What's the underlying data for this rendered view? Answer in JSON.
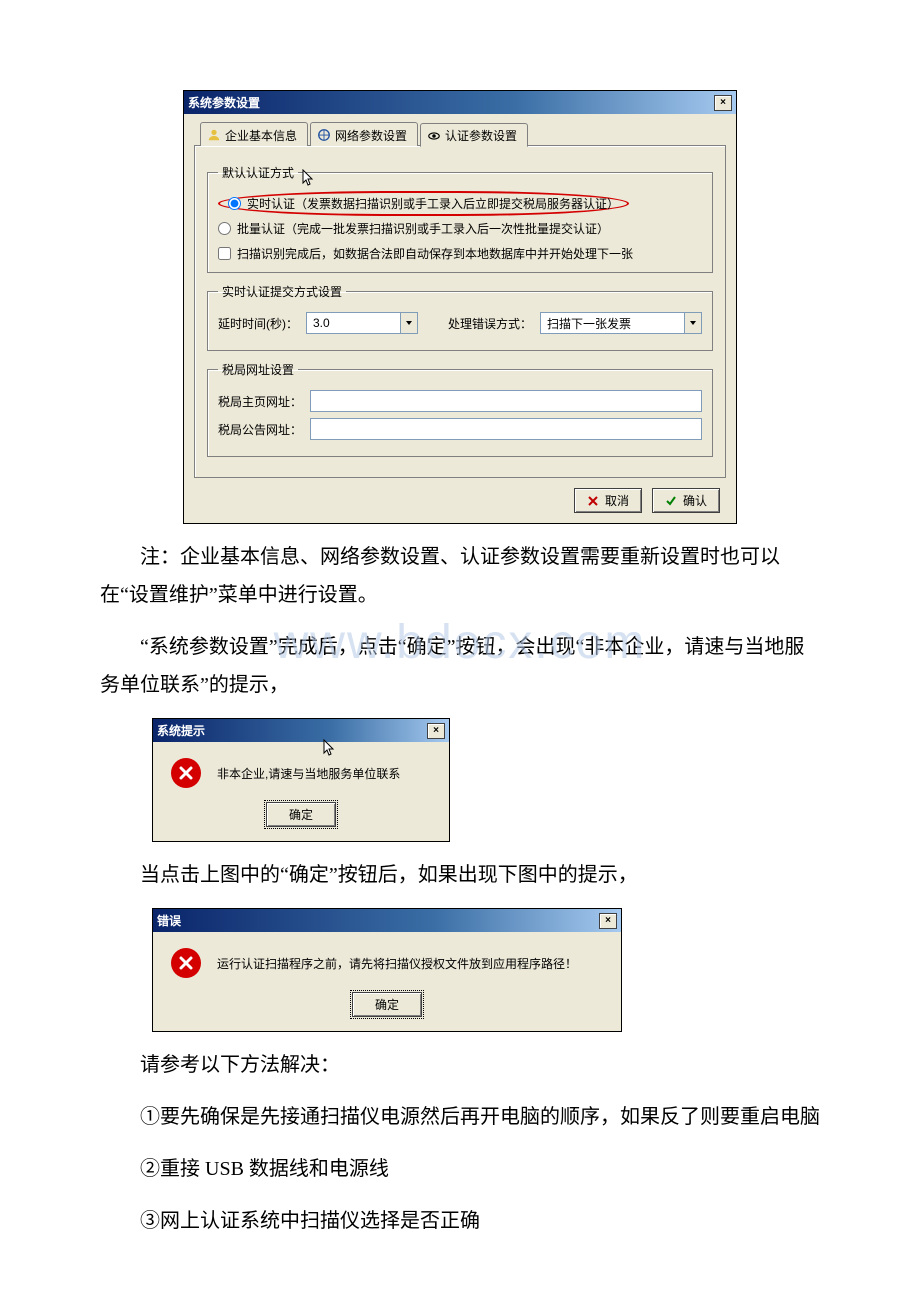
{
  "watermark": "www.bdocx.com",
  "dialog1": {
    "title": "系统参数设置",
    "tabs": {
      "basic": "企业基本信息",
      "network": "网络参数设置",
      "auth": "认证参数设置"
    },
    "group_default_auth": {
      "legend": "默认认证方式",
      "radio_realtime": "实时认证（发票数据扫描识别或手工录入后立即提交税局服务器认证）",
      "radio_batch": "批量认证（完成一批发票扫描识别或手工录入后一次性批量提交认证）",
      "chk_auto_next": "扫描识别完成后，如数据合法即自动保存到本地数据库中并开始处理下一张"
    },
    "group_realtime_submit": {
      "legend": "实时认证提交方式设置",
      "delay_label": "延时时间(秒)：",
      "delay_value": "3.0",
      "error_label": "处理错误方式：",
      "error_value": "扫描下一张发票"
    },
    "group_tax_url": {
      "legend": "税局网址设置",
      "home_label": "税局主页网址：",
      "home_value": "",
      "notice_label": "税局公告网址：",
      "notice_value": ""
    },
    "buttons": {
      "cancel": "取消",
      "ok": "确认"
    }
  },
  "para_note": "注：企业基本信息、网络参数设置、认证参数设置需要重新设置时也可以在“设置维护”菜单中进行设置。",
  "para_after_settings": "“系统参数设置”完成后，点击“确定”按钮，会出现“非本企业，请速与当地服务单位联系”的提示，",
  "dialog2": {
    "title": "系统提示",
    "message": "非本企业,请速与当地服务单位联系",
    "ok": "确定"
  },
  "para_click_ok": "当点击上图中的“确定”按钮后，如果出现下图中的提示，",
  "dialog3": {
    "title": "错误",
    "message": "运行认证扫描程序之前，请先将扫描仪授权文件放到应用程序路径！",
    "ok": "确定"
  },
  "para_solutions_header": "请参考以下方法解决：",
  "solution_1": "①要先确保是先接通扫描仪电源然后再开电脑的顺序，如果反了则要重启电脑",
  "solution_2": "②重接 USB 数据线和电源线",
  "solution_3": "③网上认证系统中扫描仪选择是否正确"
}
